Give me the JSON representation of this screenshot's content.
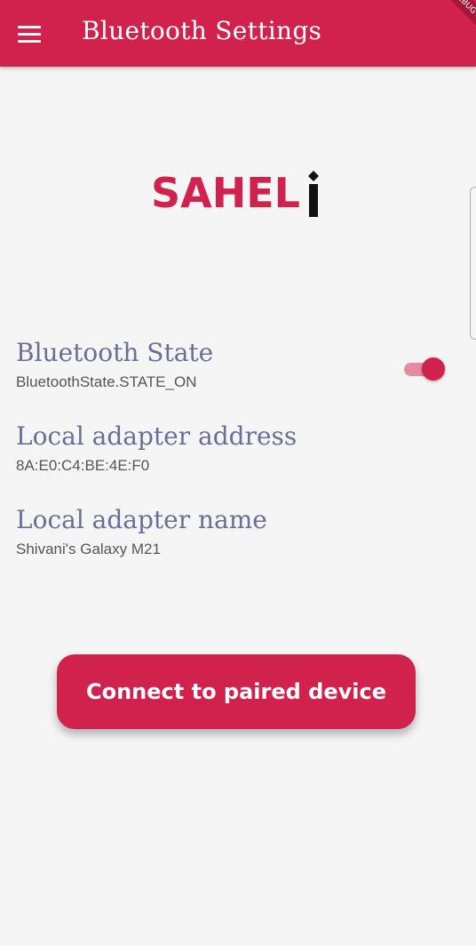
{
  "appbar": {
    "title": "Bluetooth Settings",
    "menu_icon": "hamburger-menu-icon",
    "debug_banner": "DEBUG"
  },
  "logo": {
    "text": "SAHEL",
    "suffix": "i"
  },
  "settings": {
    "bluetooth_state": {
      "title": "Bluetooth State",
      "value": "BluetoothState.STATE_ON",
      "enabled": true
    },
    "adapter_address": {
      "title": "Local adapter address",
      "value": "8A:E0:C4:BE:4E:F0"
    },
    "adapter_name": {
      "title": "Local adapter name",
      "value": "Shivani's Galaxy M21"
    }
  },
  "actions": {
    "connect_label": "Connect to paired device"
  },
  "colors": {
    "primary": "#d1224d",
    "title_text": "#6a6f96",
    "background": "#f5f5f5"
  }
}
